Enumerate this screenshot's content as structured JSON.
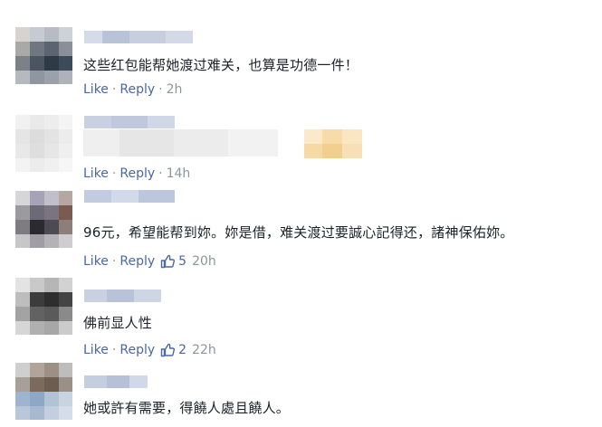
{
  "comments": [
    {
      "text": "这些红包能帮她渡过难关，也算是功德一件！",
      "like_label": "Like",
      "reply_label": "Reply",
      "time": "2h",
      "reactions": null
    },
    {
      "text": "",
      "like_label": "Like",
      "reply_label": "Reply",
      "time": "14h",
      "reactions": null
    },
    {
      "text": "96元，希望能帮到妳。妳是借，难关渡过要誠心記得还，諸神保佑妳。",
      "like_label": "Like",
      "reply_label": "Reply",
      "time": "20h",
      "reactions": "5"
    },
    {
      "text": "佛前显人性",
      "like_label": "Like",
      "reply_label": "Reply",
      "time": "22h",
      "reactions": "2"
    },
    {
      "text": "她或許有需要，得饒人處且饒人。",
      "like_label": "Like",
      "reply_label": "Reply",
      "time": "",
      "reactions": null
    }
  ],
  "colors": {
    "link": "#4b67a1",
    "meta": "#90949c",
    "text": "#1d2129"
  },
  "icons": {
    "like": "thumbs-up-icon",
    "avatar": "pixelated-avatar"
  }
}
